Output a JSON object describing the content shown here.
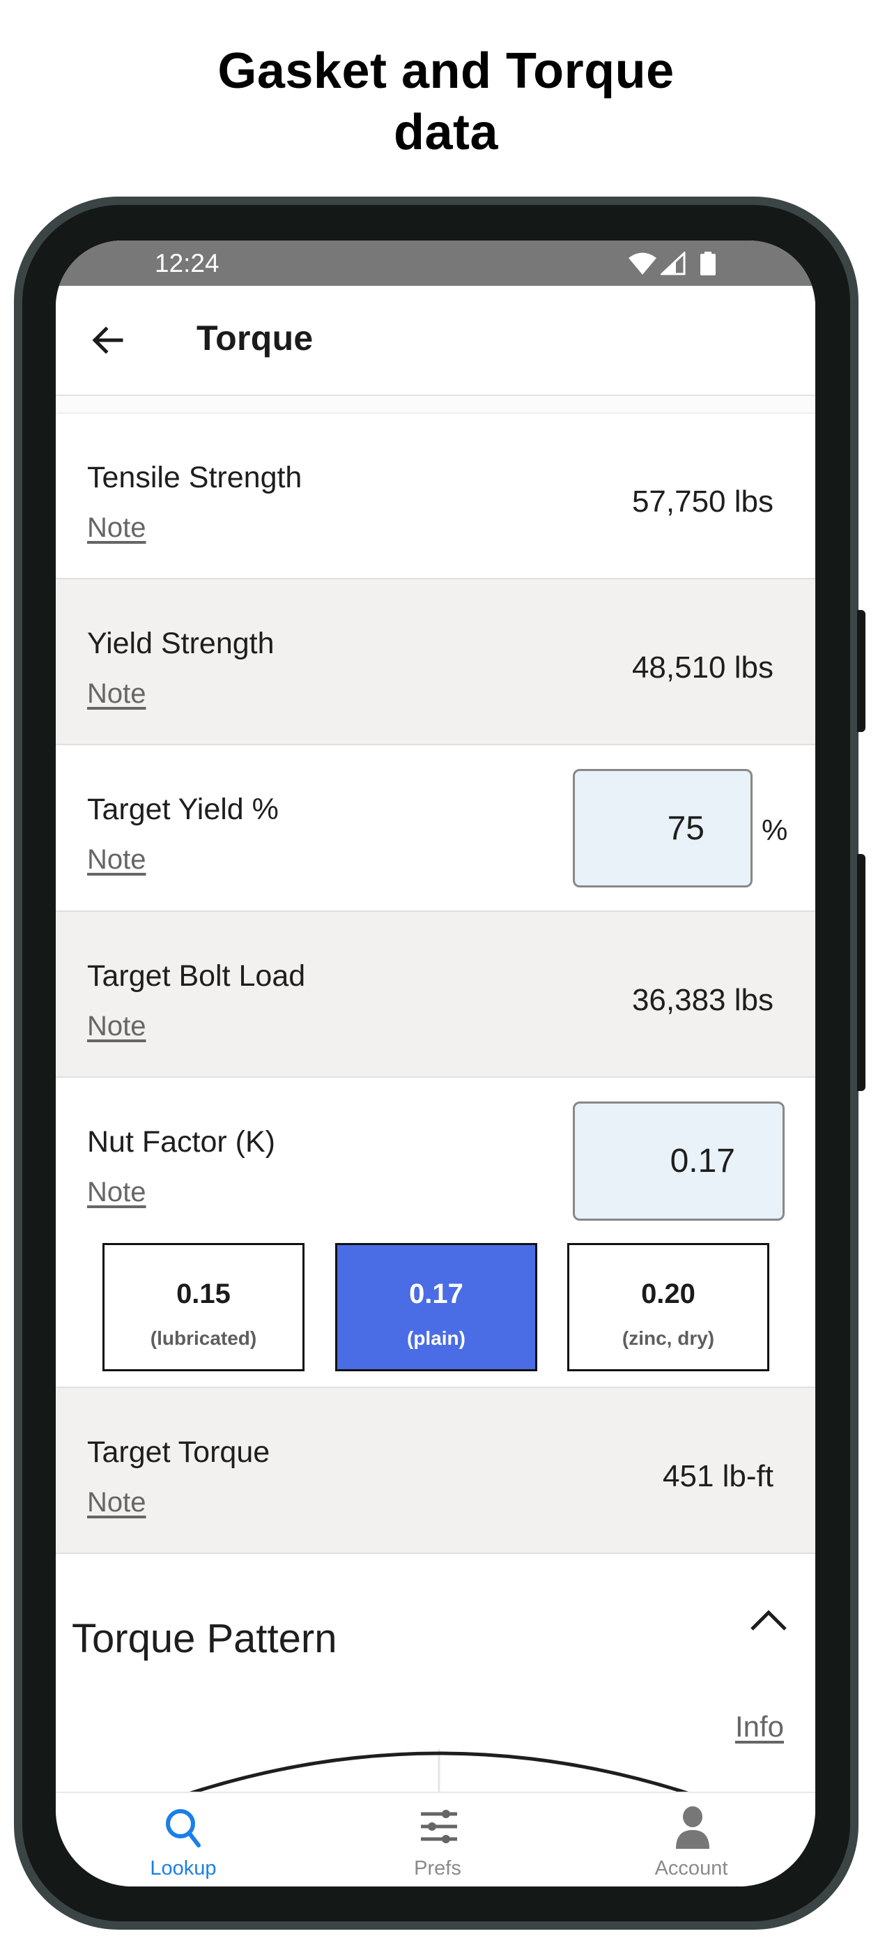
{
  "promo": {
    "title_line1": "Gasket and Torque",
    "title_line2": "data"
  },
  "status_bar": {
    "time": "12:24",
    "icons": [
      "wifi-icon",
      "signal-icon",
      "battery-icon"
    ]
  },
  "app_bar": {
    "back_icon": "arrow-left-icon",
    "title": "Torque"
  },
  "rows": [
    {
      "label": "Tensile Strength",
      "note": "Note",
      "value": "57,750 lbs"
    },
    {
      "label": "Yield Strength",
      "note": "Note",
      "value": "48,510 lbs"
    },
    {
      "label": "Target Yield %",
      "note": "Note",
      "input_value": "75",
      "unit": "%"
    },
    {
      "label": "Target Bolt Load",
      "note": "Note",
      "value": "36,383 lbs"
    },
    {
      "label": "Nut Factor (K)",
      "note": "Note",
      "input_value": "0.17"
    },
    {
      "label": "Target Torque",
      "note": "Note",
      "value": "451 lb-ft"
    }
  ],
  "nut_factor_presets": [
    {
      "value": "0.15",
      "desc": "(lubricated)",
      "selected": false
    },
    {
      "value": "0.17",
      "desc": "(plain)",
      "selected": true
    },
    {
      "value": "0.20",
      "desc": "(zinc, dry)",
      "selected": false
    }
  ],
  "torque_pattern": {
    "title": "Torque Pattern",
    "expanded": true,
    "info_link": "Info"
  },
  "bottom_nav": [
    {
      "label": "Lookup",
      "icon": "search-icon",
      "active": true
    },
    {
      "label": "Prefs",
      "icon": "sliders-icon",
      "active": false
    },
    {
      "label": "Account",
      "icon": "person-icon",
      "active": false
    }
  ],
  "colors": {
    "accent_selected": "#4a6de5",
    "nav_active": "#1a7fe8",
    "nav_inactive": "#8a8a8a",
    "input_bg": "#e8f2f8",
    "row_alt_bg": "#f2f1f0",
    "status_bar": "#787878"
  }
}
